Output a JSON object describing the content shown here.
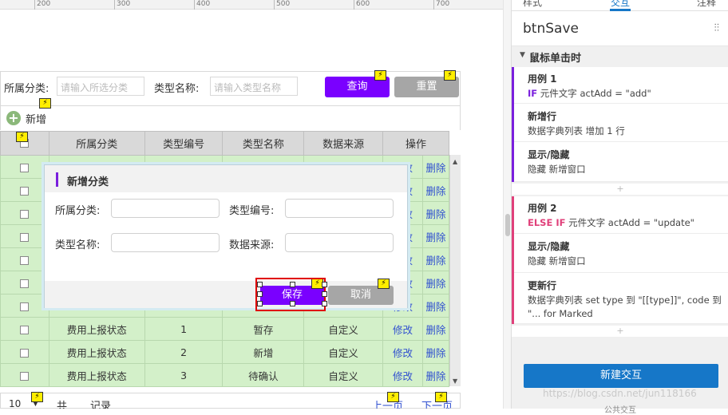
{
  "ruler": {
    "ticks": [
      "200",
      "300",
      "400",
      "500",
      "600",
      "700"
    ]
  },
  "filter": {
    "category_label": "所属分类:",
    "category_placeholder": "请输入所选分类",
    "type_name_label": "类型名称:",
    "type_name_placeholder": "请输入类型名称",
    "query_button": "查询",
    "reset_button": "重置"
  },
  "toolbar": {
    "add_label": "新增"
  },
  "table": {
    "headers": [
      "所属分类",
      "类型编号",
      "类型名称",
      "数据来源",
      "操作"
    ],
    "rows": [
      [
        "费用上报状态",
        "1",
        "暂存",
        "自定义",
        "修改",
        "删除"
      ],
      [
        "费用上报状态",
        "2",
        "新增",
        "自定义",
        "修改",
        "删除"
      ],
      [
        "费用上报状态",
        "3",
        "待确认",
        "自定义",
        "修改",
        "删除"
      ]
    ],
    "hidden_row_actions": [
      [
        "修改",
        "删除"
      ],
      [
        "修改",
        "删除"
      ],
      [
        "修改",
        "删除"
      ],
      [
        "修改",
        "删除"
      ],
      [
        "修改",
        "删除"
      ],
      [
        "修改",
        "删除"
      ],
      [
        "修改",
        "删除"
      ]
    ],
    "colors": {
      "header_bg": "#d9d9d9",
      "row_bg": "#d3f0c9",
      "link": "#3050d0"
    }
  },
  "footer": {
    "page_size": "10",
    "total": "共",
    "records": "记录",
    "prev": "上一页",
    "next": "下一页"
  },
  "dialog": {
    "title": "新增分类",
    "field_category": "所属分类:",
    "field_type_code": "类型编号:",
    "field_type_name": "类型名称:",
    "field_data_source": "数据来源:",
    "save_button": "保存",
    "cancel_button": "取消"
  },
  "panel": {
    "tabs": [
      "样式",
      "交互",
      "注释"
    ],
    "widget_name": "btnSave",
    "event_name": "鼠标单击时",
    "case1": {
      "title": "用例 1",
      "condition_kw": "IF",
      "condition": "元件文字 actAdd = \"add\"",
      "actions": [
        {
          "title": "新增行",
          "detail": "数据字典列表 增加 1 行"
        },
        {
          "title": "显示/隐藏",
          "detail": "隐藏 新增窗口"
        }
      ]
    },
    "case2": {
      "title": "用例 2",
      "condition_kw": "ELSE IF",
      "condition": "元件文字 actAdd = \"update\"",
      "actions": [
        {
          "title": "显示/隐藏",
          "detail": "隐藏 新增窗口"
        },
        {
          "title": "更新行",
          "detail": "数据字典列表 set type 到 \"[[type]]\", code 到",
          "detail2": "\"... for Marked"
        }
      ]
    },
    "new_interaction_button": "新建交互",
    "bottom_text": "公共交互",
    "watermark": "https://blog.csdn.net/jun118166"
  },
  "colors": {
    "accent_purple": "#7a00ff",
    "reset_gray": "#a6a6a6",
    "primary_blue": "#1677c8",
    "selection_red": "#e00000",
    "if_purple": "#7a1fdd",
    "elseif_pink": "#e0407a"
  }
}
